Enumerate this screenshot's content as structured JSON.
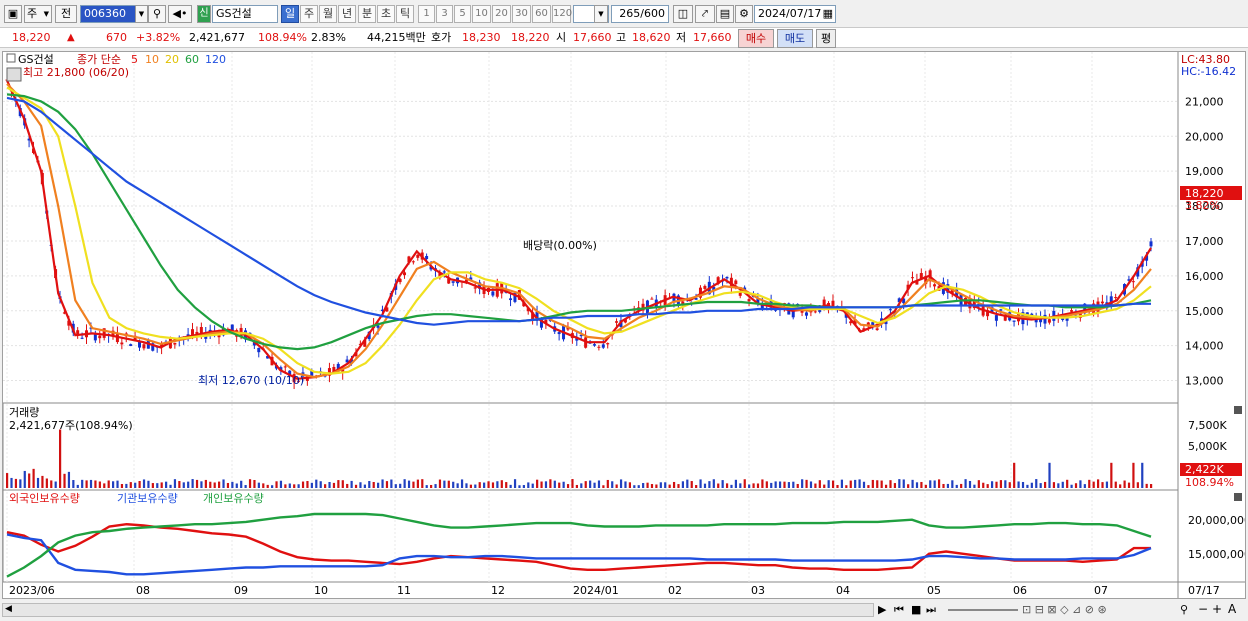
{
  "toolbar": {
    "market_type": "주",
    "market_scope": "전",
    "stock_code": "006360",
    "stock_badge": "신",
    "stock_name": "GS건설",
    "periods": [
      "일",
      "주",
      "월",
      "년",
      "분",
      "초",
      "틱"
    ],
    "active_period": "일",
    "intervals": [
      "1",
      "3",
      "5",
      "10",
      "20",
      "30",
      "60",
      "120"
    ],
    "count": "265",
    "count_total": "/600",
    "date": "2024/07/17"
  },
  "quote": {
    "price": "18,220",
    "change": "670",
    "change_pct": "+3.82%",
    "volume": "2,421,677",
    "volume_ratio": "108.94%",
    "turnover": "2.83%",
    "amount": "44,215백만",
    "bid_ask_label": "호가",
    "ask": "18,230",
    "bid": "18,220",
    "open_label": "시",
    "open": "17,660",
    "high_label": "고",
    "high": "18,620",
    "low_label": "저",
    "low": "17,660",
    "buy_label": "매수",
    "sell_label": "매도",
    "eval_label": "평"
  },
  "chart_legend": {
    "name": "GS건설",
    "ma_label": "종가 단순",
    "ma_periods": [
      "5",
      "10",
      "20",
      "60",
      "120"
    ],
    "ma_colors": [
      "#e01010",
      "#f08020",
      "#f0e020",
      "#20a040",
      "#2050e0"
    ],
    "high_note": "최고 21,800 (06/20)",
    "low_note": "최저 12,670 (10/10)",
    "dividend_note": "배당락(0.00%)",
    "lc": "LC:43.80",
    "hc": "HC:-16.42"
  },
  "price_axis": {
    "ticks": [
      "21,000",
      "20,000",
      "19,000",
      "18,000",
      "17,000",
      "16,000",
      "15,000",
      "14,000",
      "13,000"
    ],
    "current_price": "18,220",
    "current_pct": "3.82%"
  },
  "volume_panel": {
    "title": "거래량",
    "value_label": "2,421,677주(108.94%)",
    "ticks": [
      "7,500K",
      "5,000K"
    ],
    "current": "2,422K",
    "current_pct": "108.94%"
  },
  "holding_panel": {
    "legend": [
      "외국인보유수량",
      "기관보유수량",
      "개인보유수량"
    ],
    "legend_colors": [
      "#e01010",
      "#2050e0",
      "#20a040"
    ],
    "ticks": [
      "20,000,000",
      "15,000,000"
    ]
  },
  "time_axis": {
    "labels": [
      "2023/06",
      "08",
      "09",
      "10",
      "11",
      "12",
      "2024/01",
      "02",
      "03",
      "04",
      "05",
      "06",
      "07"
    ],
    "last_label": "07/17"
  },
  "chart_data": {
    "type": "candlestick",
    "title": "GS건설",
    "ylim": [
      12500,
      22300
    ],
    "y_ticks": [
      13000,
      14000,
      15000,
      16000,
      17000,
      18000,
      19000,
      20000,
      21000
    ],
    "x_range": [
      "2023/06",
      "2024/07/17"
    ],
    "series": [
      {
        "name": "5",
        "type": "line",
        "values": [
          21600,
          20500,
          19000,
          15500,
          14300,
          14350,
          14300,
          14200,
          14100,
          13950,
          14200,
          14300,
          14400,
          14450,
          14300,
          13900,
          13300,
          13050,
          13100,
          13200,
          13500,
          14200,
          14900,
          16000,
          16700,
          16200,
          15900,
          15800,
          15600,
          15600,
          15400,
          14800,
          14500,
          14300,
          14100,
          14100,
          14700,
          15000,
          15200,
          15400,
          15300,
          15600,
          15900,
          15600,
          15200,
          15100,
          15000,
          15050,
          15150,
          15000,
          14400,
          14600,
          15000,
          15800,
          16000,
          15600,
          15300,
          15050,
          14900,
          14800,
          14750,
          14800,
          14900,
          15000,
          15100,
          15300,
          16000,
          16800
        ]
      },
      {
        "name": "10",
        "type": "line",
        "values": [
          21500,
          21000,
          20300,
          18000,
          15300,
          14500,
          14400,
          14300,
          14200,
          14050,
          14150,
          14250,
          14350,
          14400,
          14350,
          14050,
          13600,
          13200,
          13100,
          13200,
          13400,
          13900,
          14600,
          15400,
          16200,
          16400,
          16100,
          15900,
          15700,
          15650,
          15500,
          15000,
          14700,
          14500,
          14250,
          14200,
          14500,
          14800,
          15000,
          15250,
          15350,
          15500,
          15700,
          15650,
          15350,
          15150,
          15050,
          15000,
          15100,
          15050,
          14600,
          14550,
          14900,
          15400,
          15900,
          15700,
          15450,
          15200,
          15000,
          14850,
          14800,
          14800,
          14850,
          14950,
          15050,
          15200,
          15600,
          16200
        ]
      },
      {
        "name": "20",
        "type": "line",
        "values": [
          21400,
          21100,
          20800,
          20000,
          18000,
          15800,
          14800,
          14500,
          14350,
          14250,
          14200,
          14250,
          14300,
          14350,
          14350,
          14200,
          13900,
          13500,
          13250,
          13200,
          13250,
          13500,
          14000,
          14600,
          15300,
          15900,
          16100,
          16100,
          15900,
          15800,
          15650,
          15350,
          15000,
          14750,
          14500,
          14350,
          14400,
          14600,
          14800,
          15000,
          15200,
          15350,
          15500,
          15550,
          15450,
          15250,
          15100,
          15050,
          15050,
          15050,
          14850,
          14650,
          14800,
          15100,
          15500,
          15700,
          15600,
          15400,
          15150,
          14950,
          14850,
          14800,
          14800,
          14850,
          14950,
          15050,
          15300,
          15700
        ]
      },
      {
        "name": "60",
        "type": "line",
        "values": [
          21200,
          21150,
          21000,
          20700,
          20200,
          19500,
          18700,
          17900,
          17100,
          16300,
          15600,
          15100,
          14700,
          14400,
          14200,
          14050,
          13950,
          13900,
          13950,
          14100,
          14300,
          14500,
          14650,
          14750,
          14850,
          14900,
          14900,
          14850,
          14800,
          14750,
          14700,
          14750,
          14850,
          14950,
          15000,
          15000,
          15000,
          15050,
          15100,
          15150,
          15200,
          15250,
          15250,
          15250,
          15200,
          15200,
          15150,
          15150,
          15100,
          15100,
          15100,
          15100,
          15100,
          15150,
          15200,
          15250,
          15300,
          15300,
          15250,
          15200,
          15150,
          15150,
          15100,
          15100,
          15100,
          15150,
          15200,
          15300
        ]
      },
      {
        "name": "120",
        "type": "line",
        "values": [
          21100,
          21000,
          20700,
          20300,
          19900,
          19500,
          19100,
          18700,
          18400,
          18100,
          17800,
          17500,
          17200,
          16900,
          16600,
          16300,
          16000,
          15700,
          15450,
          15250,
          15100,
          14950,
          14850,
          14750,
          14650,
          14600,
          14650,
          14700,
          14700,
          14700,
          14700,
          14750,
          14800,
          14800,
          14850,
          14850,
          14850,
          14900,
          14900,
          14950,
          14950,
          15000,
          15000,
          15000,
          15050,
          15050,
          15050,
          15100,
          15100,
          15100,
          15100,
          15100,
          15100,
          15150,
          15150,
          15150,
          15150,
          15150,
          15150,
          15150,
          15150,
          15150,
          15150,
          15150,
          15150,
          15150,
          15200,
          15200
        ]
      },
      {
        "name": "외국인보유수량",
        "panel": "holding",
        "values": [
          20.7,
          20.4,
          19.6,
          19.0,
          19.5,
          20.3,
          21.2,
          21.4,
          21.3,
          21.1,
          21.0,
          20.8,
          20.6,
          20.5,
          20.3,
          19.7,
          19.0,
          18.5,
          18.3,
          18.2,
          18.2,
          18.1,
          18.0,
          17.9,
          18.1,
          18.4,
          18.6,
          18.5,
          18.4,
          18.3,
          18.2,
          18.1,
          17.8,
          17.5,
          17.4,
          17.4,
          17.5,
          17.6,
          17.7,
          17.8,
          17.9,
          18.0,
          18.0,
          17.9,
          17.8,
          17.8,
          17.6,
          17.5,
          17.5,
          17.4,
          17.4,
          17.4,
          17.5,
          17.6,
          18.8,
          19.0,
          18.8,
          18.6,
          18.4,
          18.2,
          18.2,
          18.2,
          18.2,
          18.1,
          18.2,
          18.3,
          19.3,
          19.3
        ]
      },
      {
        "name": "기관보유수량",
        "panel": "holding",
        "values": [
          20.5,
          20.2,
          20.0,
          18.0,
          17.4,
          17.3,
          17.2,
          17.0,
          17.0,
          17.1,
          17.2,
          17.3,
          17.4,
          17.5,
          17.6,
          17.6,
          17.7,
          17.7,
          17.7,
          17.7,
          17.7,
          17.7,
          17.8,
          18.4,
          18.6,
          18.6,
          18.5,
          18.5,
          18.6,
          18.6,
          18.5,
          18.4,
          18.4,
          18.4,
          18.4,
          18.4,
          18.4,
          18.4,
          18.4,
          18.4,
          18.4,
          18.3,
          18.3,
          18.3,
          18.3,
          18.3,
          18.2,
          18.2,
          18.2,
          18.2,
          18.2,
          18.2,
          18.2,
          18.3,
          18.6,
          18.6,
          18.5,
          18.4,
          18.4,
          18.3,
          18.3,
          18.3,
          18.3,
          18.4,
          18.4,
          18.4,
          18.7,
          19.3
        ]
      },
      {
        "name": "개인보유수량",
        "panel": "holding",
        "values": [
          16.8,
          17.6,
          18.6,
          19.8,
          20.4,
          20.7,
          20.8,
          21.0,
          21.1,
          21.2,
          21.3,
          21.4,
          21.4,
          21.5,
          21.6,
          21.8,
          22.0,
          22.1,
          22.3,
          22.3,
          22.3,
          22.3,
          22.2,
          21.9,
          21.6,
          21.3,
          21.1,
          21.1,
          21.2,
          21.3,
          21.4,
          21.5,
          21.5,
          21.5,
          21.3,
          21.2,
          21.2,
          21.2,
          21.3,
          21.3,
          21.3,
          21.3,
          21.4,
          21.4,
          21.4,
          21.4,
          21.5,
          21.5,
          21.5,
          21.6,
          21.6,
          21.6,
          21.7,
          21.8,
          21.3,
          21.1,
          21.1,
          21.2,
          21.3,
          21.4,
          21.4,
          21.5,
          21.5,
          21.4,
          21.4,
          21.3,
          20.8,
          20.3
        ]
      }
    ],
    "holding_ylim": [
      16.5,
      23.0
    ],
    "holding_unit": "million shares"
  }
}
